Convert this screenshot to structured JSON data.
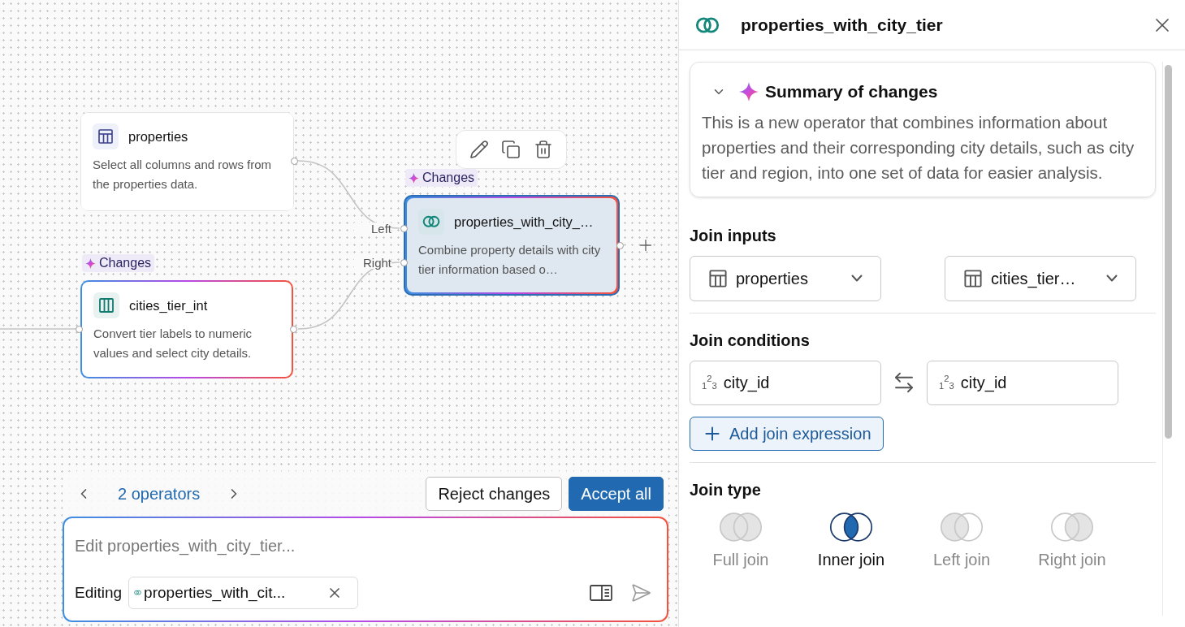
{
  "canvas": {
    "nodes": [
      {
        "kind": "table",
        "title": "properties",
        "description": "Select all columns and rows from the properties data.",
        "changed": false,
        "selected": false
      },
      {
        "kind": "columns",
        "title": "cities_tier_int",
        "description": "Convert tier labels to numeric values and select city details.",
        "changed": true,
        "badge": "Changes",
        "selected": false
      },
      {
        "kind": "join",
        "title": "properties_with_city_…",
        "description": "Combine property details with city tier information based o…",
        "changed": true,
        "badge": "Changes",
        "selected": true,
        "ports": [
          "Left",
          "Right"
        ]
      }
    ]
  },
  "review_bar": {
    "nav_label": "2 operators",
    "buttons": [
      {
        "label": "Reject changes",
        "kind": "secondary"
      },
      {
        "label": "Accept all",
        "kind": "primary"
      }
    ],
    "prompt": {
      "placeholder": "Edit properties_with_city_tier...",
      "editing_label": "Editing",
      "chip": "properties_with_cit..."
    }
  },
  "panel": {
    "title": "properties_with_city_tier",
    "summary": {
      "title": "Summary of changes",
      "expanded": true,
      "text": "This is a new operator that combines information about properties and their corresponding city details, such as city tier and region, into one set of data for easier analysis."
    },
    "join_inputs": {
      "label": "Join inputs",
      "inputs": [
        "properties",
        "cities_tier…"
      ]
    },
    "join_conditions": {
      "label": "Join conditions",
      "left": {
        "type": "$_{1}$$^{2}$$_{3}$",
        "column": "city_id"
      },
      "right": {
        "type": "$_{1}$$^{2}$$_{3}$",
        "column": "city_id"
      },
      "add_button": "Add join expression"
    },
    "join_type": {
      "label": "Join type",
      "options": [
        {
          "kind": "full",
          "label": "Full join",
          "selected": false
        },
        {
          "kind": "inner",
          "label": "Inner join",
          "selected": true
        },
        {
          "kind": "left",
          "label": "Left join",
          "selected": false
        },
        {
          "kind": "right",
          "label": "Right join",
          "selected": false
        }
      ]
    }
  }
}
